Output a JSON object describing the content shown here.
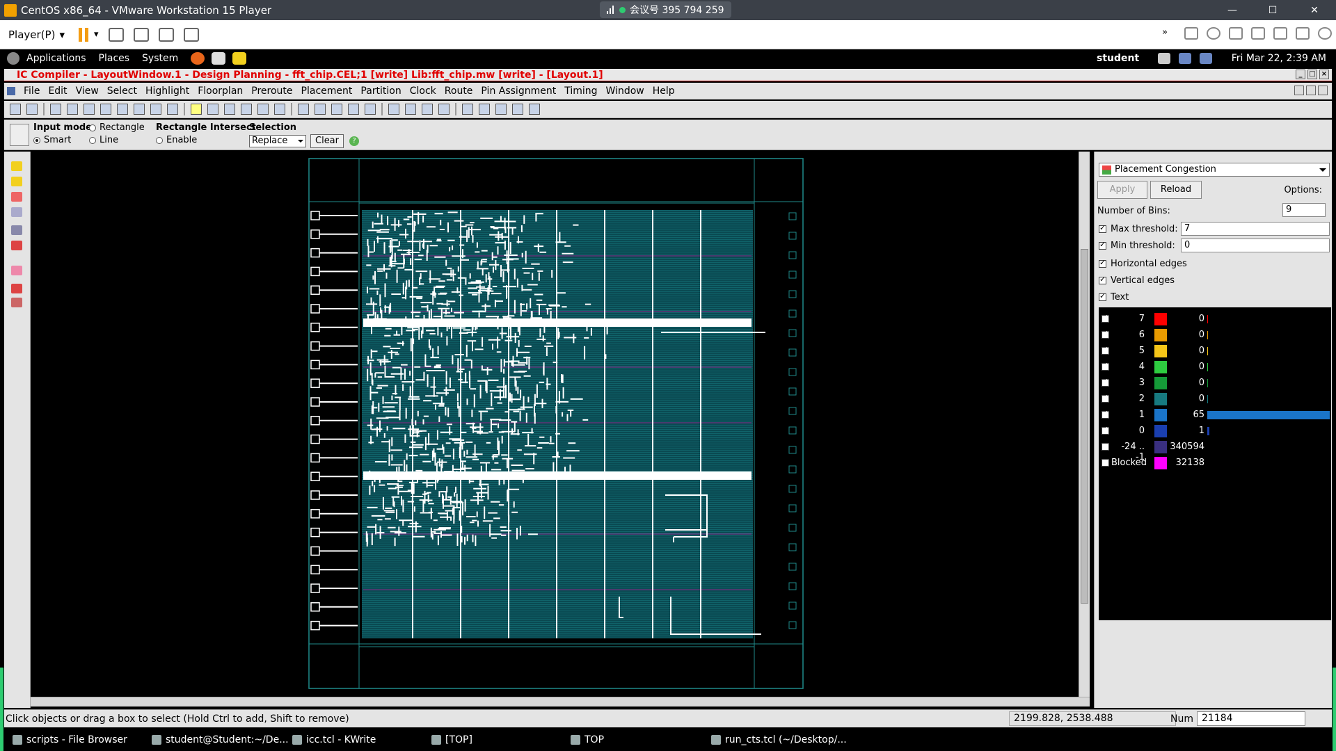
{
  "vm": {
    "title": "CentOS x86_64 - VMware Workstation 15 Player",
    "meeting": "会议号 395 794 259",
    "player_label": "Player(P)",
    "win_min": "—",
    "win_max": "☐",
    "win_close": "✕"
  },
  "gnome": {
    "menus": [
      "Applications",
      "Places",
      "System"
    ],
    "user": "student",
    "clock": "Fri Mar 22,  2:39 AM"
  },
  "icc": {
    "title": "IC Compiler - LayoutWindow.1 - Design Planning - fft_chip.CEL;1 [write]    Lib:fft_chip.mw [write] - [Layout.1]",
    "menus": [
      "File",
      "Edit",
      "View",
      "Select",
      "Highlight",
      "Floorplan",
      "Preroute",
      "Placement",
      "Partition",
      "Clock",
      "Route",
      "Pin Assignment",
      "Timing",
      "Window",
      "Help"
    ],
    "options": {
      "input_mode_label": "Input mode",
      "smart": "Smart",
      "rectangle": "Rectangle",
      "line": "Line",
      "rect_intersect_label": "Rectangle Intersect",
      "enable": "Enable",
      "selection_label": "Selection",
      "selection_value": "Replace",
      "clear": "Clear",
      "help_glyph": "?"
    }
  },
  "panel": {
    "view": "Placement Congestion",
    "apply": "Apply",
    "reload": "Reload",
    "options": "Options:",
    "bins_label": "Number of Bins:",
    "bins_value": "9",
    "max_label": "Max threshold:",
    "max_value": "7",
    "min_label": "Min threshold:",
    "min_value": "0",
    "horizontal": "Horizontal edges",
    "vertical": "Vertical edges",
    "text": "Text",
    "legend": [
      {
        "label": "7",
        "color": "#ff0000",
        "count": "0",
        "checked": true,
        "fraction": 0
      },
      {
        "label": "6",
        "color": "#e89a00",
        "count": "0",
        "checked": true,
        "fraction": 0
      },
      {
        "label": "5",
        "color": "#f5c518",
        "count": "0",
        "checked": true,
        "fraction": 0
      },
      {
        "label": "4",
        "color": "#2ecc40",
        "count": "0",
        "checked": true,
        "fraction": 0
      },
      {
        "label": "3",
        "color": "#159a38",
        "count": "0",
        "checked": true,
        "fraction": 0
      },
      {
        "label": "2",
        "color": "#177a80",
        "count": "0",
        "checked": true,
        "fraction": 0
      },
      {
        "label": "1",
        "color": "#1a74c8",
        "count": "65",
        "checked": true,
        "fraction": 1.0
      },
      {
        "label": "0",
        "color": "#1a3fb0",
        "count": "1",
        "checked": true,
        "fraction": 0.015
      },
      {
        "label": "-24 .. -1",
        "color": "#3a2f80",
        "count": "340594",
        "checked": false,
        "fraction": 0
      },
      {
        "label": "Blocked",
        "color": "#ff00ff",
        "count": "32138",
        "checked": false,
        "fraction": 0
      }
    ]
  },
  "status": {
    "message": "Click objects or drag a box to select (Hold Ctrl to add, Shift to remove)",
    "coord": "2199.828, 2538.488",
    "num_label": "Num",
    "num_value": "21184"
  },
  "taskbar": [
    {
      "label": "scripts - File Browser"
    },
    {
      "label": "student@Student:~/De..."
    },
    {
      "label": "icc.tcl - KWrite"
    },
    {
      "label": "[TOP]"
    },
    {
      "label": "TOP"
    },
    {
      "label": "run_cts.tcl (~/Desktop/..."
    }
  ],
  "colors": {
    "die_line": "#1f8a8a",
    "core_fill": "#0a4a52",
    "wire": "#ffffff",
    "title_red": "#e00000"
  }
}
